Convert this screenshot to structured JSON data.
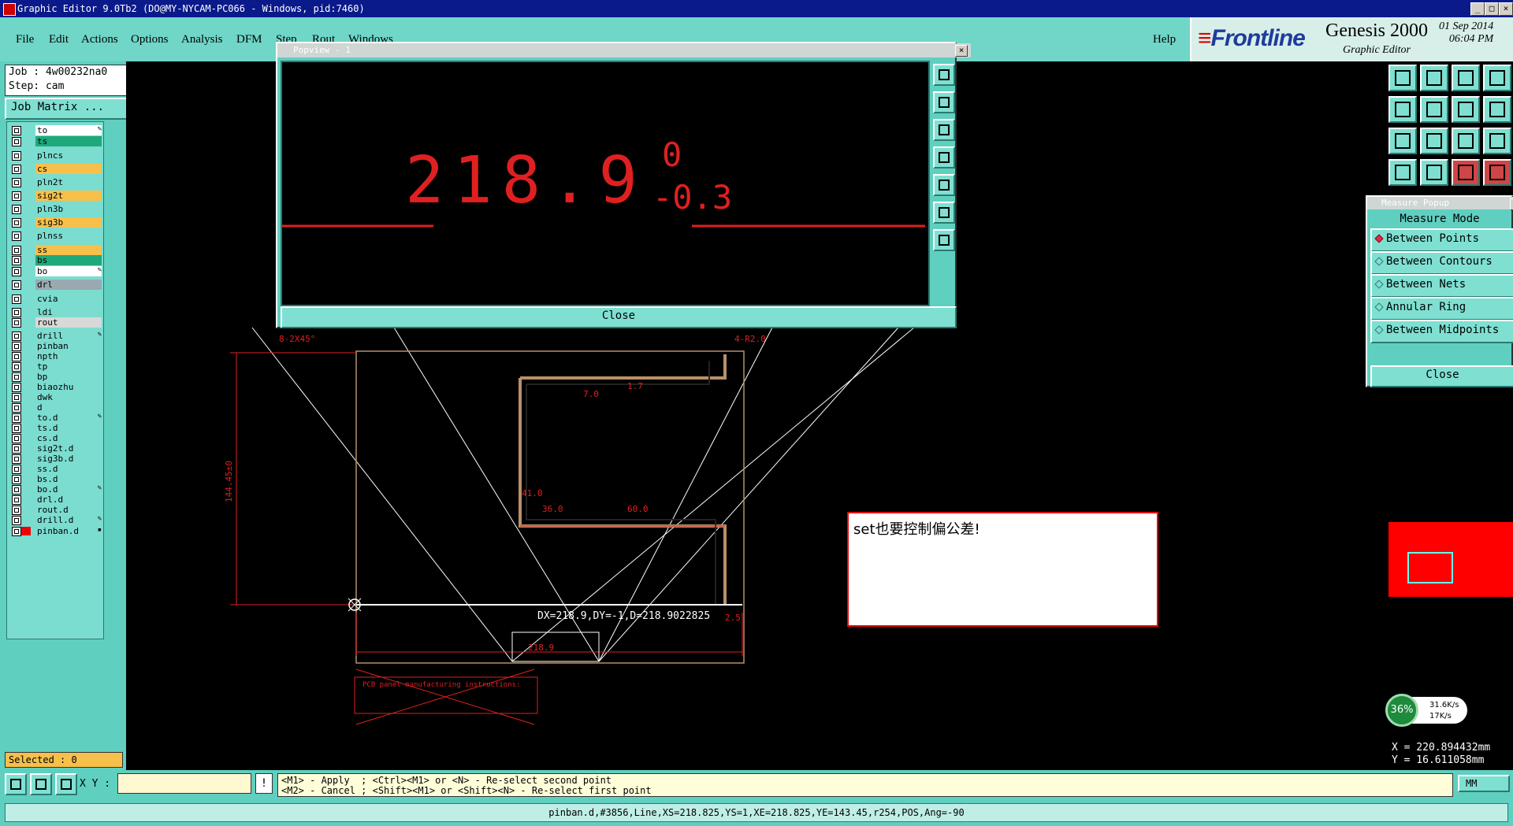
{
  "window": {
    "title": "Graphic Editor 9.0Tb2 (DO@MY-NYCAM-PC066 - Windows, pid:7460)",
    "min": "_",
    "max": "□",
    "close": "×"
  },
  "menu": {
    "items": [
      "File",
      "Edit",
      "Actions",
      "Options",
      "Analysis",
      "DFM",
      "Step",
      "Rout",
      "Windows"
    ],
    "help": "Help"
  },
  "brand": {
    "logo_f": "F",
    "logo_rest": "rontline",
    "product": "Genesis 2000",
    "subtitle": "Graphic Editor",
    "date": "01 Sep 2014",
    "time": "06:04 PM"
  },
  "job": {
    "job_label": "Job : 4w00232na0",
    "step_label": "Step: cam",
    "matrix_btn": "Job Matrix ..."
  },
  "layers": [
    {
      "name": "to",
      "color": "#ffffff",
      "mark": "✎"
    },
    {
      "name": "ts",
      "color": "#1fa87a",
      "mark": ""
    },
    {
      "name": "plncs",
      "color": "#7bdcd0",
      "mark": ""
    },
    {
      "name": "cs",
      "color": "#f6c04b",
      "mark": ""
    },
    {
      "name": "pln2t",
      "color": "#7bdcd0",
      "mark": ""
    },
    {
      "name": "sig2t",
      "color": "#f6c04b",
      "mark": ""
    },
    {
      "name": "pln3b",
      "color": "#7bdcd0",
      "mark": ""
    },
    {
      "name": "sig3b",
      "color": "#f6c04b",
      "mark": ""
    },
    {
      "name": "plnss",
      "color": "#7bdcd0",
      "mark": ""
    },
    {
      "name": "ss",
      "color": "#f6c04b",
      "mark": ""
    },
    {
      "name": "bs",
      "color": "#1fa87a",
      "mark": ""
    },
    {
      "name": "bo",
      "color": "#ffffff",
      "mark": "✎"
    },
    {
      "name": "drl",
      "color": "#9aa9b0",
      "mark": ""
    },
    {
      "name": "cvia",
      "color": "#7bdcd0",
      "mark": ""
    },
    {
      "name": "ldi",
      "color": "#7bdcd0",
      "mark": ""
    },
    {
      "name": "rout",
      "color": "#d8d8d8",
      "mark": ""
    },
    {
      "name": "drill",
      "color": "#7bdcd0",
      "mark": "✎"
    },
    {
      "name": "pinban",
      "color": "#7bdcd0",
      "mark": ""
    },
    {
      "name": "npth",
      "color": "#7bdcd0",
      "mark": ""
    },
    {
      "name": "tp",
      "color": "#7bdcd0",
      "mark": ""
    },
    {
      "name": "bp",
      "color": "#7bdcd0",
      "mark": ""
    },
    {
      "name": "biaozhu",
      "color": "#7bdcd0",
      "mark": ""
    },
    {
      "name": "dwk",
      "color": "#7bdcd0",
      "mark": ""
    },
    {
      "name": "d",
      "color": "#7bdcd0",
      "mark": ""
    },
    {
      "name": "to.d",
      "color": "#7bdcd0",
      "mark": "✎"
    },
    {
      "name": "ts.d",
      "color": "#7bdcd0",
      "mark": ""
    },
    {
      "name": "cs.d",
      "color": "#7bdcd0",
      "mark": ""
    },
    {
      "name": "sig2t.d",
      "color": "#7bdcd0",
      "mark": ""
    },
    {
      "name": "sig3b.d",
      "color": "#7bdcd0",
      "mark": ""
    },
    {
      "name": "ss.d",
      "color": "#7bdcd0",
      "mark": ""
    },
    {
      "name": "bs.d",
      "color": "#7bdcd0",
      "mark": ""
    },
    {
      "name": "bo.d",
      "color": "#7bdcd0",
      "mark": "✎"
    },
    {
      "name": "drl.d",
      "color": "#7bdcd0",
      "mark": ""
    },
    {
      "name": "rout.d",
      "color": "#7bdcd0",
      "mark": ""
    },
    {
      "name": "drill.d",
      "color": "#7bdcd0",
      "mark": "✎"
    },
    {
      "name": "pinban.d",
      "color": "#7bdcd0",
      "mark": "▪"
    }
  ],
  "selected": "Selected : 0",
  "popview": {
    "title": "Popview - 1",
    "close_x": "×",
    "dimension": "218.9",
    "tol_upper": "0",
    "tol_lower": "-0.3",
    "close_label": "Close"
  },
  "measure": {
    "title": "Measure Popup",
    "close_x": "×",
    "heading": "Measure Mode",
    "options": [
      "Between Points",
      "Between Contours",
      "Between Nets",
      "Annular Ring",
      "Between Midpoints"
    ],
    "selected_option": "Between Points",
    "close_label": "Close"
  },
  "drawing": {
    "label_8x": "8-2X45°",
    "label_4r": "4-R2.0",
    "dim_144": "144.45±0",
    "dim_7": "7.0",
    "dim_17": "1.7",
    "dim_41": "41.0",
    "dim_36": "36.0",
    "dim_60": "60.0",
    "dim_218": "218.9",
    "dim_25": "2.5",
    "measure_readout": "DX=218.9,DY=-1,D=218.9022825",
    "pcb_note_title": "PCB panel manufacturing instructions:"
  },
  "note": {
    "text": "set也要控制偏公差!"
  },
  "speed": {
    "percent": "36%",
    "up": "31.6K/s",
    "down": "17K/s"
  },
  "coords": {
    "x": "X = 220.894432mm",
    "y": "Y = 16.611058mm"
  },
  "bottom": {
    "xy_label": "X Y :",
    "xy_value": "",
    "excl": "!",
    "hint_line1": "<M1> - Apply  ; <Ctrl><M1> or <N> - Re-select second point",
    "hint_line2": "<M2> - Cancel ; <Shift><M1> or <Shift><N> - Re-select first point",
    "unit": "MM"
  },
  "status": "pinban.d,#3856,Line,XS=218.825,YS=1,XE=218.825,YE=143.45,r254,POS,Ang=-90",
  "colors": {
    "accent": "#5fcfc0",
    "drawing_red": "#ff2020",
    "outline": "#b8906a"
  }
}
